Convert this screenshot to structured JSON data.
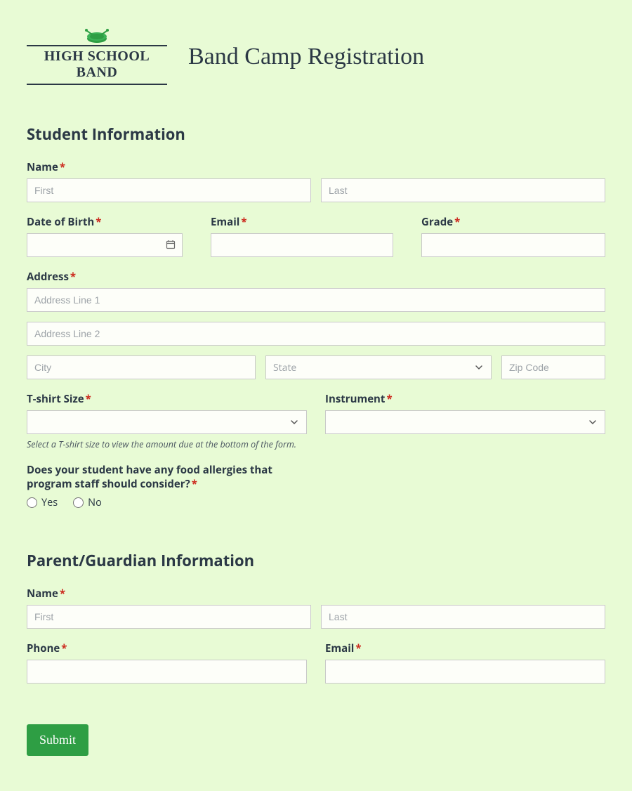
{
  "header": {
    "logo_text": "HIGH SCHOOL BAND",
    "title": "Band Camp Registration"
  },
  "student": {
    "section_title": "Student Information",
    "name_label": "Name",
    "first_placeholder": "First",
    "last_placeholder": "Last",
    "dob_label": "Date of Birth",
    "email_label": "Email",
    "grade_label": "Grade",
    "address_label": "Address",
    "addr1_placeholder": "Address Line 1",
    "addr2_placeholder": "Address Line 2",
    "city_placeholder": "City",
    "state_placeholder": "State",
    "zip_placeholder": "Zip Code",
    "tshirt_label": "T-shirt Size",
    "tshirt_hint": "Select a T-shirt size to view the amount due at the bottom of the form.",
    "instrument_label": "Instrument",
    "allergy_label": "Does your student have any food allergies that program staff should consider?",
    "allergy_yes": "Yes",
    "allergy_no": "No"
  },
  "parent": {
    "section_title": "Parent/Guardian Information",
    "name_label": "Name",
    "first_placeholder": "First",
    "last_placeholder": "Last",
    "phone_label": "Phone",
    "email_label": "Email"
  },
  "submit_label": "Submit",
  "required_marker": "*"
}
